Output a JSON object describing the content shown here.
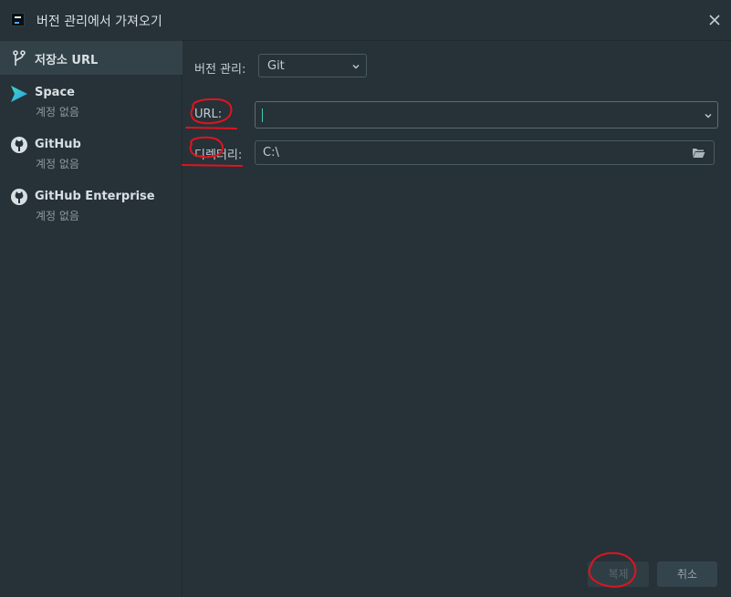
{
  "window": {
    "title": "버전 관리에서 가져오기"
  },
  "sidebar": {
    "items": [
      {
        "label": "저장소 URL",
        "icon": "branch-icon"
      },
      {
        "label": "Space",
        "sub": "계정 없음",
        "icon": "space-icon"
      },
      {
        "label": "GitHub",
        "sub": "계정 없음",
        "icon": "github-icon"
      },
      {
        "label": "GitHub Enterprise",
        "sub": "계정 없음",
        "icon": "github-icon"
      }
    ]
  },
  "form": {
    "vcs_label": "버전 관리:",
    "vcs_value": "Git",
    "url_label": "URL:",
    "url_value": "",
    "dir_label": "디렉터리:",
    "dir_value": "C:\\"
  },
  "buttons": {
    "clone": "복제",
    "cancel": "취소"
  },
  "colors": {
    "accent": "#3ccbb4",
    "background": "#263238",
    "selected": "#334249",
    "annotation": "#e0141e"
  }
}
